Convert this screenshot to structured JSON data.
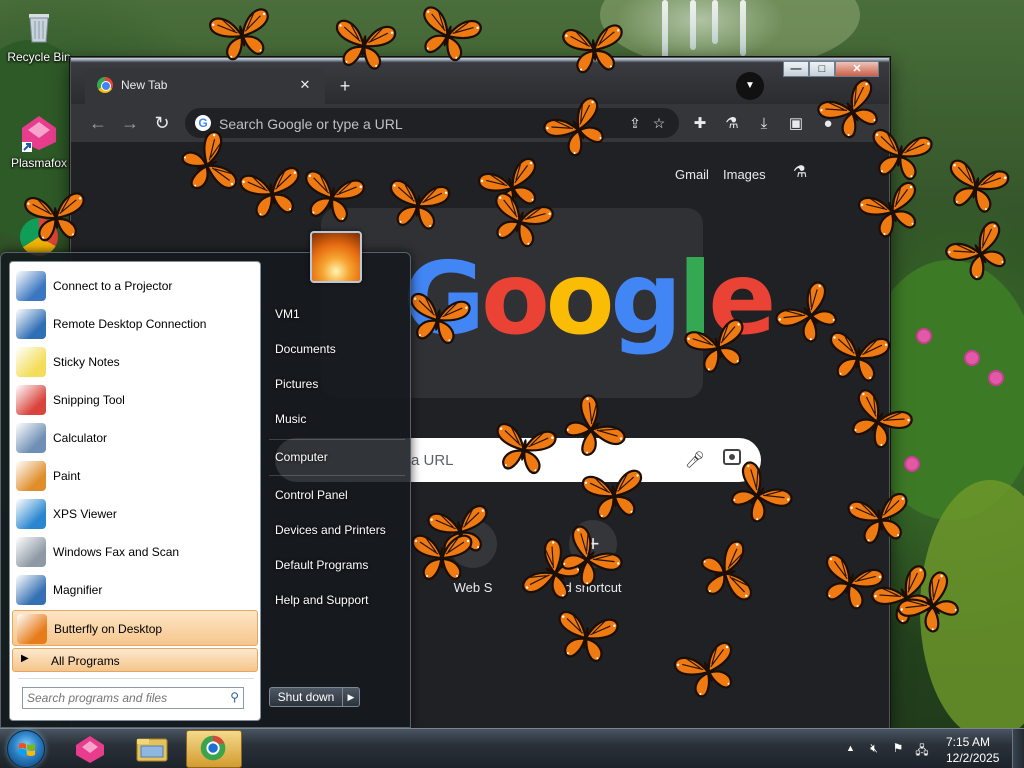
{
  "desktop": {
    "icons": [
      {
        "label": "Recycle Bin",
        "icon": "recycle-bin-icon"
      },
      {
        "label": "Plasmafox",
        "icon": "plasmafox-icon"
      }
    ]
  },
  "browser": {
    "tab": {
      "title": "New Tab",
      "close": "✕"
    },
    "new_tab": "+",
    "window_controls": {
      "minimize": "—",
      "maximize": "□",
      "close": "✕"
    },
    "omnibox": {
      "placeholder": "Search Google or type a URL"
    },
    "header_links": {
      "gmail": "Gmail",
      "images": "Images"
    },
    "logo_text": "Google",
    "search": {
      "placeholder_visible": "a URL"
    },
    "shortcuts": [
      {
        "label": "Web S",
        "icon": "web-store-icon"
      },
      {
        "label": "d shortcut",
        "icon": "add-shortcut-icon"
      }
    ]
  },
  "start_menu": {
    "programs": [
      {
        "label": "Connect to a Projector",
        "icon": "projector-icon",
        "color": "#3b76c0"
      },
      {
        "label": "Remote Desktop Connection",
        "icon": "remote-desktop-icon",
        "color": "#2f6fb5"
      },
      {
        "label": "Sticky Notes",
        "icon": "sticky-notes-icon",
        "color": "#f3dd5a"
      },
      {
        "label": "Snipping Tool",
        "icon": "scissors-icon",
        "color": "#d9443c"
      },
      {
        "label": "Calculator",
        "icon": "calculator-icon",
        "color": "#6f8fb4"
      },
      {
        "label": "Paint",
        "icon": "paint-icon",
        "color": "#e08e2c"
      },
      {
        "label": "XPS Viewer",
        "icon": "xps-viewer-icon",
        "color": "#2a87cf"
      },
      {
        "label": "Windows Fax and Scan",
        "icon": "fax-icon",
        "color": "#8e99a5"
      },
      {
        "label": "Magnifier",
        "icon": "magnifier-icon",
        "color": "#3470b3"
      },
      {
        "label": "Butterfly on Desktop",
        "icon": "butterfly-icon",
        "color": "#e77c1b"
      }
    ],
    "all_programs": "All Programs",
    "search_placeholder": "Search programs and files",
    "right_items": [
      "VM1",
      "Documents",
      "Pictures",
      "Music",
      "Computer",
      "Control Panel",
      "Devices and Printers",
      "Default Programs",
      "Help and Support"
    ],
    "shutdown": "Shut down"
  },
  "taskbar": {
    "clock": {
      "time": "7:15 AM",
      "date": "12/2/2025"
    },
    "apps": [
      "plasmafox-taskbar-icon",
      "explorer-taskbar-icon",
      "chrome-taskbar-icon"
    ]
  },
  "colors": {
    "accent": "#f6c68d",
    "butterfly": "#f07a12",
    "chrome_dark": "#202124"
  }
}
